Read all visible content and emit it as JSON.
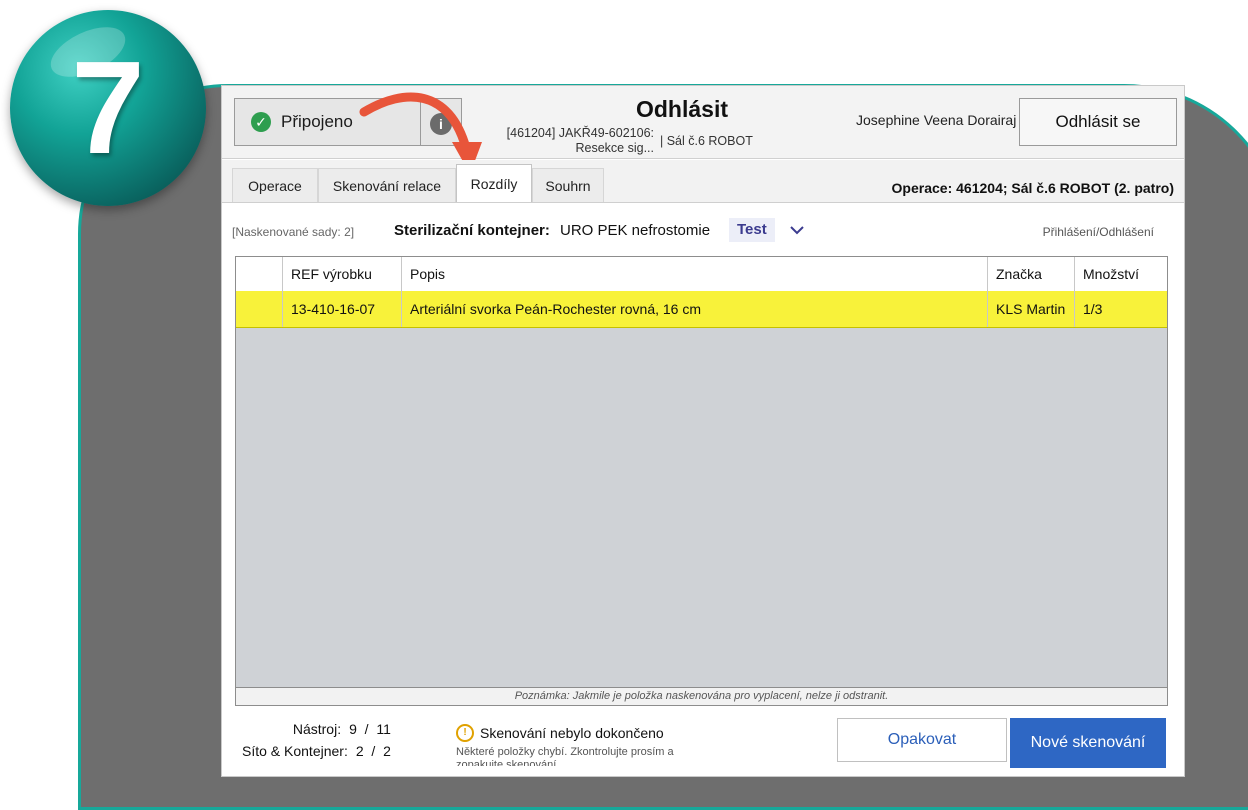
{
  "step": {
    "number": "7"
  },
  "header": {
    "connection_label": "Připojeno",
    "title": "Odhlásit",
    "case_line1": "[461204] JAKŘ49-602106:",
    "case_line2": "Resekce sig...",
    "room": "| Sál č.6 ROBOT",
    "user_name": "Josephine Veena Dorairaj",
    "logout_label": "Odhlásit se"
  },
  "tabs": [
    {
      "label": "Operace"
    },
    {
      "label": "Skenování relace"
    },
    {
      "label": "Rozdíly",
      "active": true
    },
    {
      "label": "Souhrn"
    }
  ],
  "operation_label": "Operace: 461204; Sál č.6 ROBOT (2. patro)",
  "subheader": {
    "scanned_sets": "[Naskenované sady: 2]",
    "container_label": "Sterilizační kontejner:",
    "container_value": "URO PEK nefrostomie",
    "badge": "Test",
    "login_link": "Přihlášení/Odhlášení"
  },
  "table": {
    "columns": [
      "",
      "REF výrobku",
      "Popis",
      "Značka",
      "Množství"
    ],
    "rows": [
      {
        "ref": "13-410-16-07",
        "desc": "Arteriální svorka Peán-Rochester rovná, 16 cm",
        "brand": "KLS Martin",
        "qty": "1/3"
      }
    ],
    "highlight_color": "#f8f23a"
  },
  "note": "Poznámka: Jakmile je položka naskenována pro vyplacení, nelze ji odstranit.",
  "footer": {
    "tool_label": "Nástroj:",
    "tool_value": "9  /  11",
    "set_label": "Síto & Kontejner:",
    "set_value": "2  /  2",
    "warning_title": "Skenování nebylo dokončeno",
    "warning_text": "Některé položky chybí. Zkontrolujte prosím a zopakujte skenování.",
    "retry_label": "Opakovat",
    "new_scan_label": "Nové skenování"
  },
  "colors": {
    "accent": "#2e67c4",
    "frame": "#17a89a",
    "connected": "#2e9e4f",
    "arrow": "#e8553a"
  }
}
